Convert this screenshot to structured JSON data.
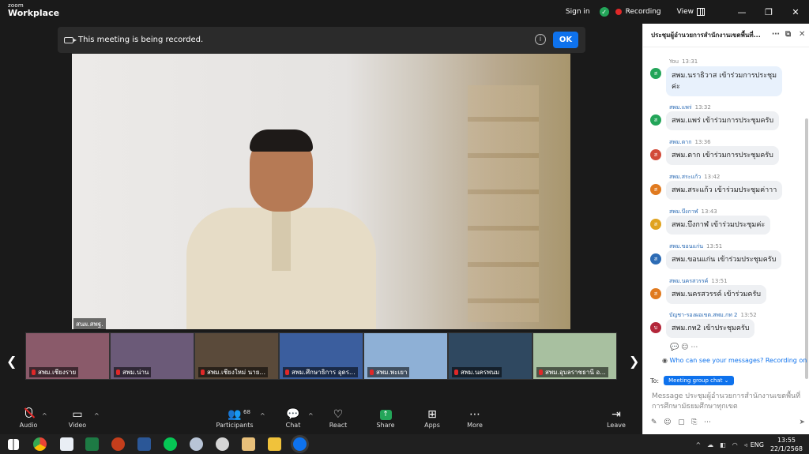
{
  "app": {
    "logo_top": "zoom",
    "logo_bottom": "Workplace",
    "signin": "Sign in",
    "recording_status": "Recording",
    "view": "View"
  },
  "banner": {
    "text": "This meeting is being recorded.",
    "info": "i",
    "ok": "OK"
  },
  "main_video": {
    "label": "สนผ.สพฐ."
  },
  "thumbnails": [
    {
      "name": "สพม.เชียงราย",
      "bg": "#8a5a6a"
    },
    {
      "name": "สพม.น่าน",
      "bg": "#6b5a78"
    },
    {
      "name": "สพม.เชียงใหม่ นาย...",
      "bg": "#5a4a3a"
    },
    {
      "name": "สพม.ศึกษาธิการ อุดร...",
      "bg": "#3b5e9e"
    },
    {
      "name": "สพม.พะเยา",
      "bg": "#8eb0d6"
    },
    {
      "name": "สพม.นครพนม",
      "bg": "#2f4860"
    },
    {
      "name": "สพม.อุบลราชธานี อ...",
      "bg": "#a8c0a0"
    }
  ],
  "toolbar": {
    "audio": "Audio",
    "video": "Video",
    "participants": "Participants",
    "participants_count": "68",
    "chat": "Chat",
    "react": "React",
    "share": "Share",
    "apps": "Apps",
    "more": "More",
    "leave": "Leave"
  },
  "chat": {
    "title": "ประชุมผู้อำนวยการสำนักงานเขตพื้นที่...",
    "messages": [
      {
        "sender": "You",
        "time": "13:31",
        "text1": "สพม.นราธิวาส เข้าร่วมการประชุม",
        "text2": "ค่ะ",
        "initial": "ส",
        "color": "#23a559",
        "mine": true
      },
      {
        "sender": "สพม.แพร่",
        "time": "13:32",
        "text1": "สพม.แพร่ เข้าร่วมการประชุมครับ",
        "initial": "ส",
        "color": "#23a559"
      },
      {
        "sender": "สพม.ตาก",
        "time": "13:36",
        "text1": "สพม.ตาก เข้าร่วมการประชุมครับ",
        "initial": "ส",
        "color": "#d24b3a"
      },
      {
        "sender": "สพม.สระแก้ว",
        "time": "13:42",
        "text1": "สพม.สระแก้ว เข้าร่วมประชุมค่าาา",
        "initial": "ส",
        "color": "#e07a1f"
      },
      {
        "sender": "สพม.บึงกาฬ",
        "time": "13:43",
        "text1": "สพม.บึงกาฬ เข้าร่วมประชุมค่ะ",
        "initial": "ส",
        "color": "#e0a31f"
      },
      {
        "sender": "สพม.ขอนแก่น",
        "time": "13:51",
        "text1": "สพม.ขอนแก่น เข้าร่วมประชุมครับ",
        "initial": "ส",
        "color": "#2d6cb5"
      },
      {
        "sender": "สพม.นครสวรรค์",
        "time": "13:51",
        "text1": "สพม.นครสวรรค์ เข้าร่วมครับ",
        "initial": "ส",
        "color": "#e07a1f"
      },
      {
        "sender": "บัญชา-รองผอเขต.สพม.กท 2",
        "time": "13:52",
        "text1": "สพม.กท2 เข้าประชุมครับ",
        "initial": "บ",
        "color": "#b3263a"
      }
    ],
    "who_can_see": "Who can see your messages? Recording on",
    "to_label": "To:",
    "to_target": "Meeting group chat",
    "compose_placeholder_1": "Message ประชุมผู้อำนวยการสำนักงานเขตพื้นที่",
    "compose_placeholder_2": "การศึกษามัธยมศึกษาทุกเขต"
  },
  "taskbar": {
    "lang": "ENG",
    "time": "13:55",
    "date": "22/1/2568"
  }
}
